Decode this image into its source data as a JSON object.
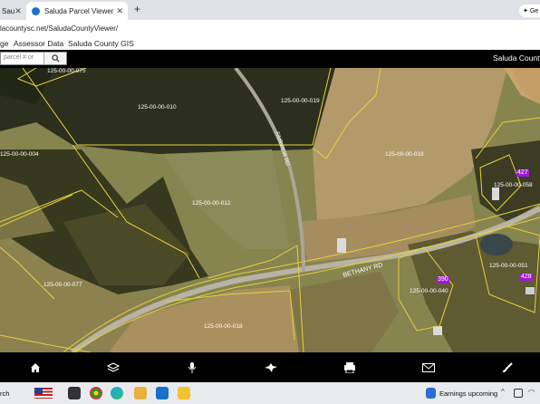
{
  "browser": {
    "tabs": [
      {
        "label": "Sau",
        "active": false
      },
      {
        "label": "Saluda Parcel Viewer",
        "active": true
      }
    ],
    "new_tab_symbol": "+",
    "gemini_label": "Ge",
    "url": "lacountysc.net/SaludaCountyViewer/"
  },
  "app_menu": {
    "items": [
      "ge",
      "Assessor Data",
      "Saluda County GIS"
    ]
  },
  "header": {
    "search_placeholder": "parcel # or",
    "title": "Saluda County"
  },
  "map": {
    "road_label": "BETHANY RD",
    "side_road_label": "FAIRVIEW RD",
    "parcels": [
      {
        "id": "125-00-00-075"
      },
      {
        "id": "125-00-00-010"
      },
      {
        "id": "125-00-00-019"
      },
      {
        "id": "125-00-00-004"
      },
      {
        "id": "125-00-00-033"
      },
      {
        "id": "125-00-00-012"
      },
      {
        "id": "125-00-00-058"
      },
      {
        "id": "125-00-00-077"
      },
      {
        "id": "125-00-00-051"
      },
      {
        "id": "125-00-00-040"
      },
      {
        "id": "125-00-00-018"
      }
    ],
    "address_badges": [
      "427",
      "390",
      "428"
    ]
  },
  "toolbar": {
    "icons": [
      "home-icon",
      "layers-icon",
      "microphone-icon",
      "bird-icon",
      "print-icon",
      "mail-icon",
      "brush-icon"
    ]
  },
  "taskbar": {
    "search_text": "rch",
    "notification": "Earnings upcoming"
  }
}
